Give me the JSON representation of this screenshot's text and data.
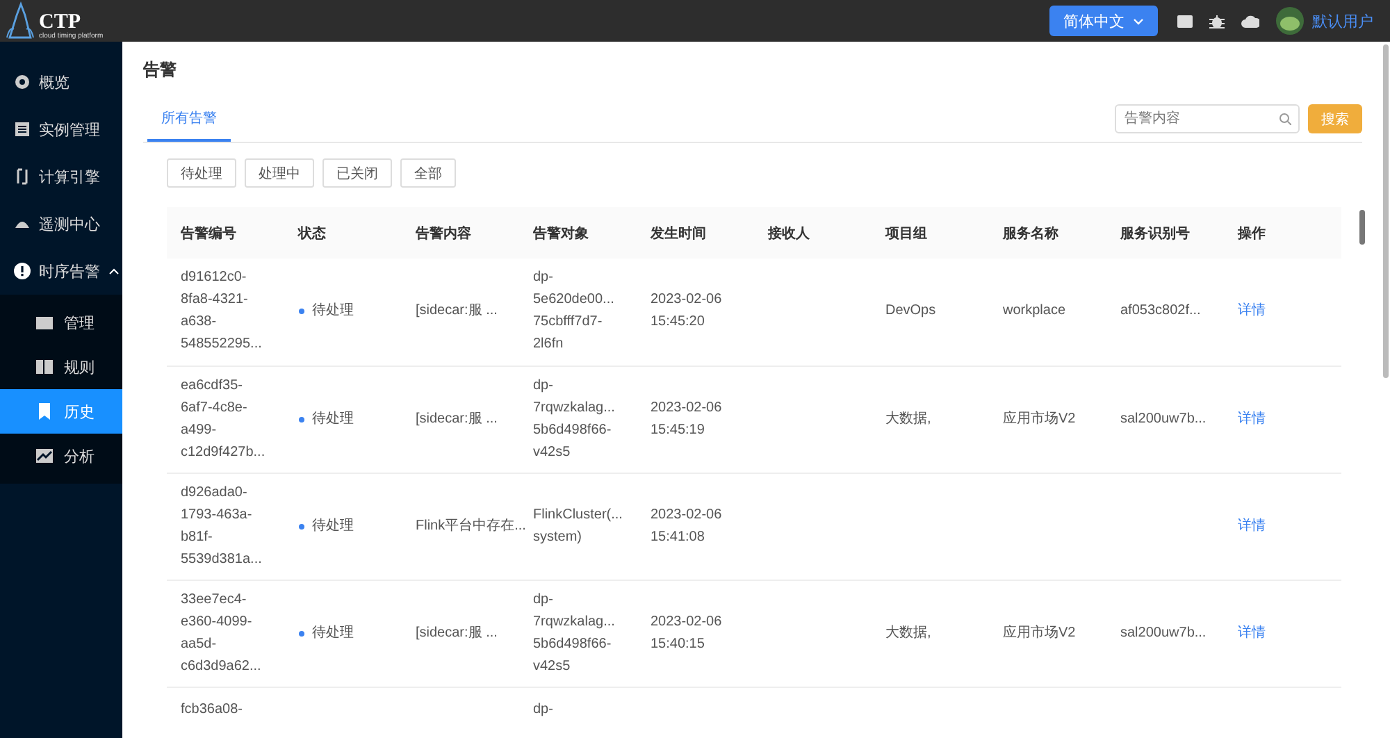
{
  "topbar": {
    "logo": "CTP",
    "logo_subtitle": "cloud timing platform",
    "language": "简体中文",
    "user": "默认用户"
  },
  "sidebar": {
    "items": [
      {
        "label": "概览",
        "selected": false
      },
      {
        "label": "实例管理",
        "selected": false
      },
      {
        "label": "计算引擎",
        "selected": false
      },
      {
        "label": "遥测中心",
        "selected": false
      },
      {
        "label": "时序告警",
        "selected": false,
        "expanded": true,
        "children": [
          {
            "label": "管理",
            "selected": false
          },
          {
            "label": "规则",
            "selected": false
          },
          {
            "label": "历史",
            "selected": true
          },
          {
            "label": "分析",
            "selected": false
          }
        ]
      }
    ]
  },
  "page": {
    "title": "告警",
    "tabs": [
      {
        "label": "所有告警",
        "selected": true
      }
    ],
    "search": {
      "placeholder": "告警内容",
      "button": "搜索"
    },
    "filters": [
      "待处理",
      "处理中",
      "已关闭",
      "全部"
    ]
  },
  "table": {
    "columns": [
      "告警编号",
      "状态",
      "告警内容",
      "告警对象",
      "发生时间",
      "接收人",
      "项目组",
      "服务名称",
      "服务识别号",
      "操作"
    ],
    "rows": [
      {
        "id": "d91612c0-\n8fa8-4321-\na638-\n548552295...",
        "status": "待处理",
        "content": "[sidecar:服 ...",
        "target": "dp-\n5e620de00...\n75cbfff7d7-\n2l6fn",
        "time": "2023-02-06\n15:45:20",
        "receiver": "",
        "project": "DevOps",
        "service": "workplace",
        "service_id": "af053c802f...",
        "action": "详情"
      },
      {
        "id": "ea6cdf35-\n6af7-4c8e-\na499-\nc12d9f427b...",
        "status": "待处理",
        "content": "[sidecar:服 ...",
        "target": "dp-\n7rqwzkalag...\n5b6d498f66-\nv42s5",
        "time": "2023-02-06\n15:45:19",
        "receiver": "",
        "project": "大数据,",
        "service": "应用市场V2",
        "service_id": "sal200uw7b...",
        "action": "详情"
      },
      {
        "id": "d926ada0-\n1793-463a-\nb81f-\n5539d381a...",
        "status": "待处理",
        "content": "Flink平台中存在...",
        "target": "FlinkCluster(...\nsystem)",
        "time": "2023-02-06\n15:41:08",
        "receiver": "",
        "project": "",
        "service": "",
        "service_id": "",
        "action": "详情"
      },
      {
        "id": "33ee7ec4-\ne360-4099-\naa5d-\nc6d3d9a62...",
        "status": "待处理",
        "content": "[sidecar:服 ...",
        "target": "dp-\n7rqwzkalag...\n5b6d498f66-\nv42s5",
        "time": "2023-02-06\n15:40:15",
        "receiver": "",
        "project": "大数据,",
        "service": "应用市场V2",
        "service_id": "sal200uw7b...",
        "action": "详情"
      },
      {
        "id": "fcb36a08-",
        "status": "",
        "content": "",
        "target": "dp-",
        "time": "",
        "receiver": "",
        "project": "",
        "service": "",
        "service_id": "",
        "action": ""
      }
    ]
  }
}
